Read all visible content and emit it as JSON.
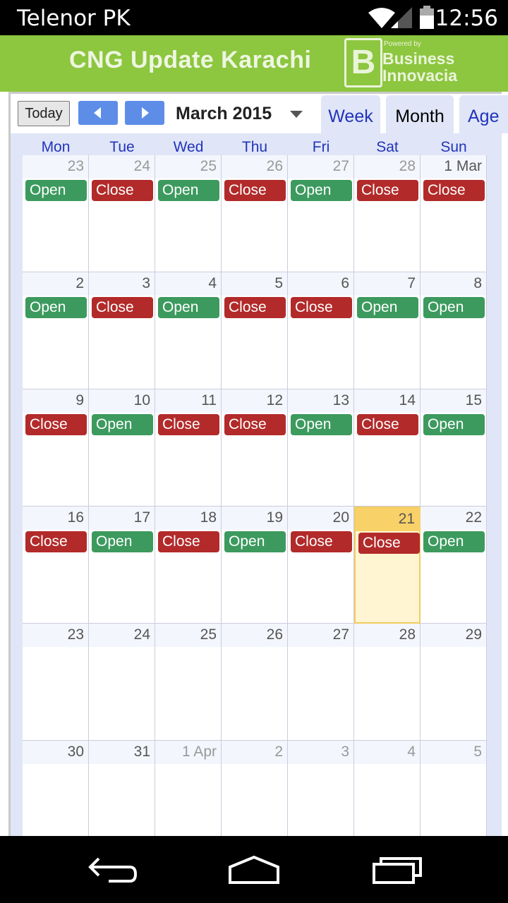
{
  "status_bar": {
    "carrier": "Telenor PK",
    "time": "12:56"
  },
  "app": {
    "title": "CNG Update Karachi",
    "logo": {
      "powered": "Powered by",
      "line1": "Business",
      "line2": "Innovacia"
    }
  },
  "toolbar": {
    "today_label": "Today",
    "month_label": "March 2015",
    "tabs": {
      "week": "Week",
      "month": "Month",
      "agenda": "Age"
    }
  },
  "colors": {
    "open": "#3c9a5e",
    "close": "#b22a2a",
    "header_green": "#8dc63f",
    "nav_blue": "#5e8de8",
    "today_highlight": "#f8d168"
  },
  "weekdays": [
    "Mon",
    "Tue",
    "Wed",
    "Thu",
    "Fri",
    "Sat",
    "Sun"
  ],
  "weeks": [
    [
      {
        "day": "23",
        "other": true,
        "status": "Open"
      },
      {
        "day": "24",
        "other": true,
        "status": "Close"
      },
      {
        "day": "25",
        "other": true,
        "status": "Open"
      },
      {
        "day": "26",
        "other": true,
        "status": "Close"
      },
      {
        "day": "27",
        "other": true,
        "status": "Open"
      },
      {
        "day": "28",
        "other": true,
        "status": "Close"
      },
      {
        "day": "1 Mar",
        "status": "Close"
      }
    ],
    [
      {
        "day": "2",
        "status": "Open"
      },
      {
        "day": "3",
        "status": "Close"
      },
      {
        "day": "4",
        "status": "Open"
      },
      {
        "day": "5",
        "status": "Close"
      },
      {
        "day": "6",
        "status": "Close"
      },
      {
        "day": "7",
        "status": "Open"
      },
      {
        "day": "8",
        "status": "Open"
      }
    ],
    [
      {
        "day": "9",
        "status": "Close"
      },
      {
        "day": "10",
        "status": "Open"
      },
      {
        "day": "11",
        "status": "Close"
      },
      {
        "day": "12",
        "status": "Close"
      },
      {
        "day": "13",
        "status": "Open"
      },
      {
        "day": "14",
        "status": "Close"
      },
      {
        "day": "15",
        "status": "Open"
      }
    ],
    [
      {
        "day": "16",
        "status": "Close"
      },
      {
        "day": "17",
        "status": "Open"
      },
      {
        "day": "18",
        "status": "Close"
      },
      {
        "day": "19",
        "status": "Open"
      },
      {
        "day": "20",
        "status": "Close"
      },
      {
        "day": "21",
        "status": "Close",
        "today": true
      },
      {
        "day": "22",
        "status": "Open"
      }
    ],
    [
      {
        "day": "23"
      },
      {
        "day": "24"
      },
      {
        "day": "25"
      },
      {
        "day": "26"
      },
      {
        "day": "27"
      },
      {
        "day": "28"
      },
      {
        "day": "29"
      }
    ],
    [
      {
        "day": "30"
      },
      {
        "day": "31"
      },
      {
        "day": "1 Apr",
        "other": true
      },
      {
        "day": "2",
        "other": true
      },
      {
        "day": "3",
        "other": true
      },
      {
        "day": "4",
        "other": true
      },
      {
        "day": "5",
        "other": true
      }
    ]
  ],
  "nav_icons": [
    "back-icon",
    "home-icon",
    "recents-icon"
  ]
}
